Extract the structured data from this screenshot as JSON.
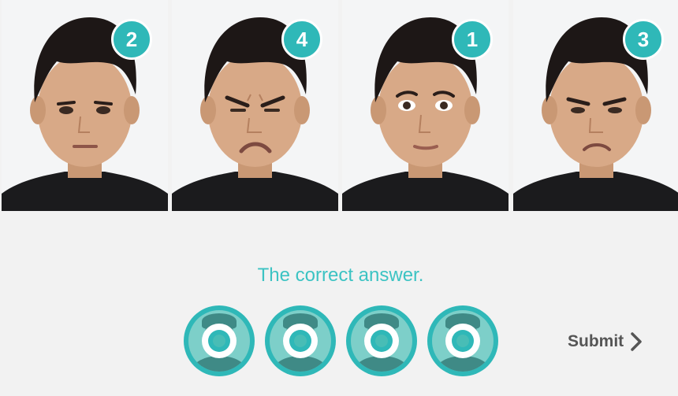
{
  "photos": [
    {
      "badge": "2",
      "expression": "neutral-serious"
    },
    {
      "badge": "4",
      "expression": "strong-disgust"
    },
    {
      "badge": "1",
      "expression": "neutral"
    },
    {
      "badge": "3",
      "expression": "mild-disgust"
    }
  ],
  "answer": {
    "label": "The correct answer.",
    "slot_count": 4
  },
  "submit": {
    "label": "Submit",
    "icon": "chevron-right-icon"
  },
  "colors": {
    "accent": "#2fb8b8",
    "label_teal": "#3cc3c3",
    "background": "#f2f2f2",
    "submit_text": "#555555"
  }
}
